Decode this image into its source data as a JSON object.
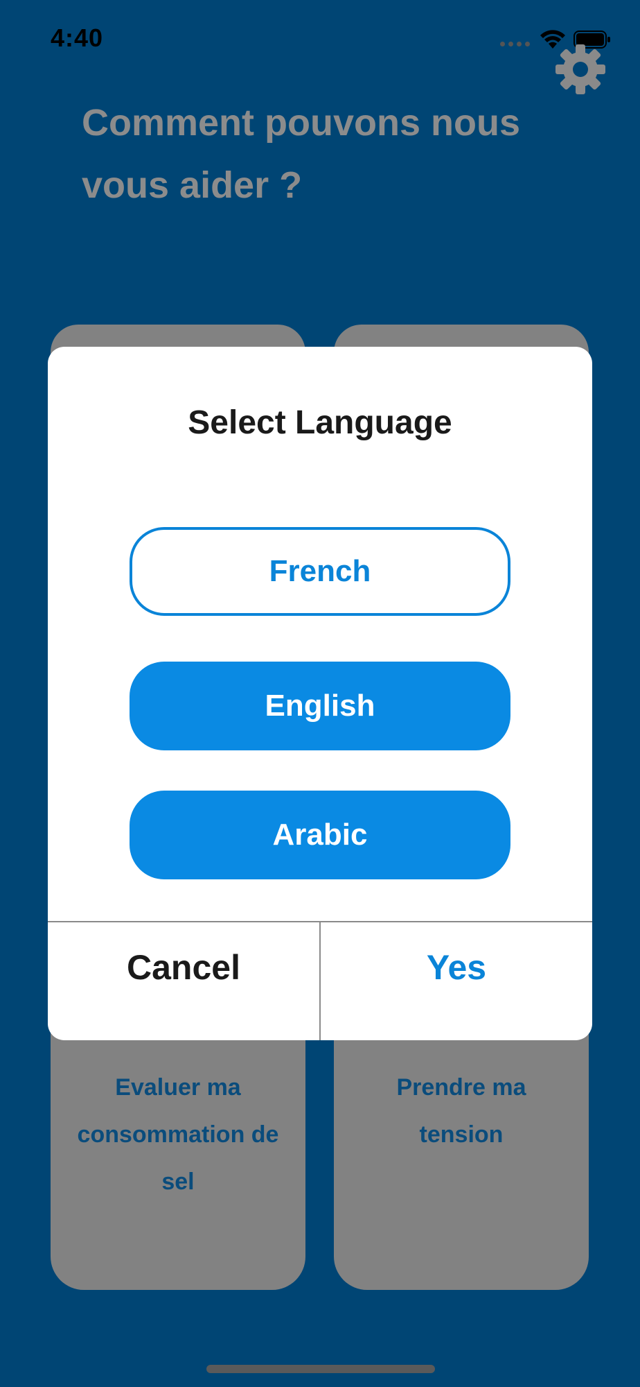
{
  "status_bar": {
    "time": "4:40",
    "icons": [
      "cellular-signal-icon",
      "wifi-icon",
      "battery-icon"
    ]
  },
  "header": {
    "title": "Comment pouvons nous vous aider ?",
    "settings_icon": "gear-icon"
  },
  "cards": [
    {
      "label": "Evaluer ma consommation de sel"
    },
    {
      "label": "Prendre ma tension"
    }
  ],
  "dialog": {
    "title": "Select Language",
    "options": [
      {
        "label": "French",
        "selected": true
      },
      {
        "label": "English",
        "selected": false
      },
      {
        "label": "Arabic",
        "selected": false
      }
    ],
    "cancel_label": "Cancel",
    "confirm_label": "Yes"
  },
  "colors": {
    "background": "#004574",
    "overlay_card": "#828282",
    "accent": "#0a8ae3",
    "heading_text": "#8c8c8c"
  }
}
